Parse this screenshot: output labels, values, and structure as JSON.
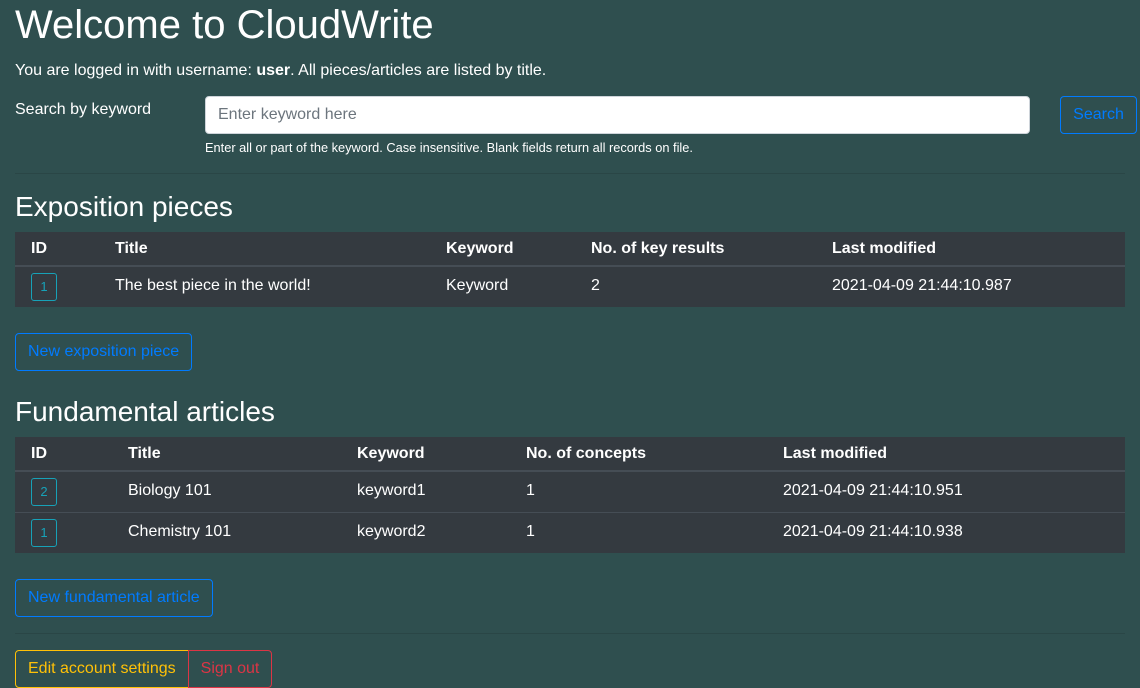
{
  "header": {
    "title": "Welcome to CloudWrite",
    "intro_prefix": "You are logged in with username: ",
    "username": "user",
    "intro_suffix": ". All pieces/articles are listed by title."
  },
  "search": {
    "label": "Search by keyword",
    "placeholder": "Enter keyword here",
    "value": "",
    "help": "Enter all or part of the keyword. Case insensitive. Blank fields return all records on file.",
    "button": "Search"
  },
  "exposition": {
    "heading": "Exposition pieces",
    "columns": [
      "ID",
      "Title",
      "Keyword",
      "No. of key results",
      "Last modified"
    ],
    "rows": [
      {
        "id": "1",
        "title": "The best piece in the world!",
        "keyword": "Keyword",
        "count": "2",
        "modified": "2021-04-09 21:44:10.987"
      }
    ],
    "new_button": "New exposition piece"
  },
  "fundamental": {
    "heading": "Fundamental articles",
    "columns": [
      "ID",
      "Title",
      "Keyword",
      "No. of concepts",
      "Last modified"
    ],
    "rows": [
      {
        "id": "2",
        "title": "Biology 101",
        "keyword": "keyword1",
        "count": "1",
        "modified": "2021-04-09 21:44:10.951"
      },
      {
        "id": "1",
        "title": "Chemistry 101",
        "keyword": "keyword2",
        "count": "1",
        "modified": "2021-04-09 21:44:10.938"
      }
    ],
    "new_button": "New fundamental article"
  },
  "footer": {
    "edit_button": "Edit account settings",
    "signout_button": "Sign out"
  },
  "colors": {
    "background": "#2f4f4f",
    "table": "#343a40",
    "primary": "#007bff",
    "info": "#17a2b8",
    "warning": "#ffc107",
    "danger": "#dc3545"
  }
}
